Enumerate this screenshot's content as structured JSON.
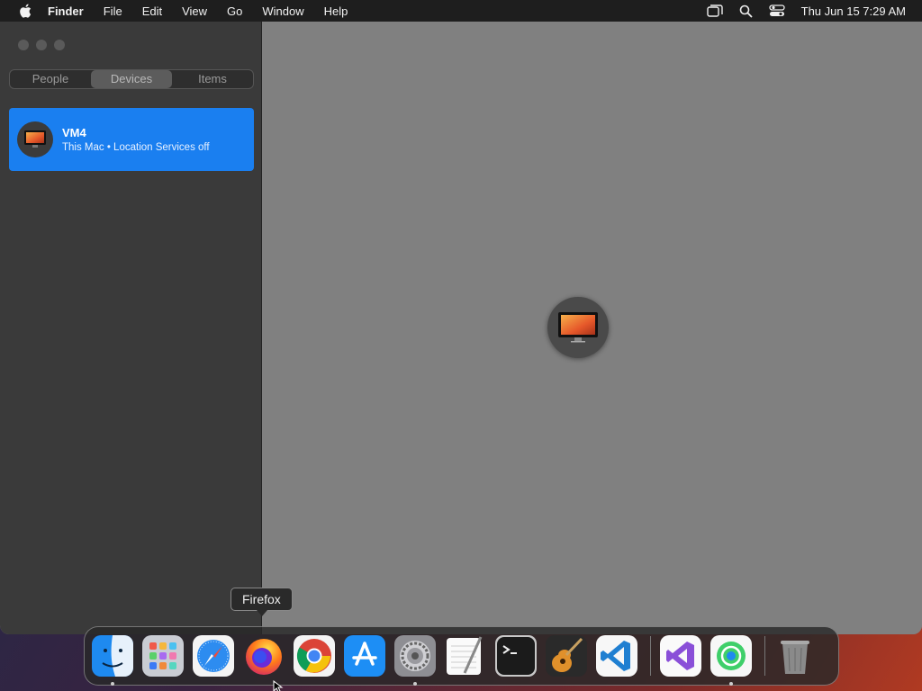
{
  "menubar": {
    "app_name": "Finder",
    "items": [
      "File",
      "Edit",
      "View",
      "Go",
      "Window",
      "Help"
    ],
    "clock": "Thu Jun 15  7:29 AM",
    "status_icons": [
      "window-stack-icon",
      "search-icon",
      "control-center-icon"
    ]
  },
  "sidebar": {
    "tabs": [
      {
        "label": "People",
        "active": false
      },
      {
        "label": "Devices",
        "active": true
      },
      {
        "label": "Items",
        "active": false
      }
    ],
    "devices": [
      {
        "name": "VM4",
        "subtitle": "This Mac • Location Services off",
        "selected": true
      }
    ]
  },
  "tooltip": {
    "label": "Firefox"
  },
  "dock": {
    "apps": [
      {
        "name": "Finder",
        "icon": "finder-icon",
        "running": true
      },
      {
        "name": "Launchpad",
        "icon": "launchpad-icon",
        "running": false
      },
      {
        "name": "Safari",
        "icon": "safari-icon",
        "running": false
      },
      {
        "name": "Firefox",
        "icon": "firefox-icon",
        "running": false
      },
      {
        "name": "Chrome",
        "icon": "chrome-icon",
        "running": false
      },
      {
        "name": "App Store",
        "icon": "app-store-icon",
        "running": false
      },
      {
        "name": "System Settings",
        "icon": "settings-icon",
        "running": true
      },
      {
        "name": "TextEdit",
        "icon": "textedit-icon",
        "running": false
      },
      {
        "name": "Terminal",
        "icon": "terminal-icon",
        "running": false
      },
      {
        "name": "GarageBand",
        "icon": "garageband-icon",
        "running": false
      },
      {
        "name": "Visual Studio Code",
        "icon": "vscode-icon",
        "running": false
      }
    ],
    "recent_apps": [
      {
        "name": "Visual Studio",
        "icon": "visual-studio-icon",
        "running": false
      },
      {
        "name": "Find My",
        "icon": "find-my-icon",
        "running": true
      }
    ],
    "trash": {
      "name": "Trash",
      "icon": "trash-icon"
    }
  },
  "colors": {
    "accent": "#1a7ff0",
    "map_bg": "#808080",
    "sidebar_bg": "#3a3a3a"
  }
}
